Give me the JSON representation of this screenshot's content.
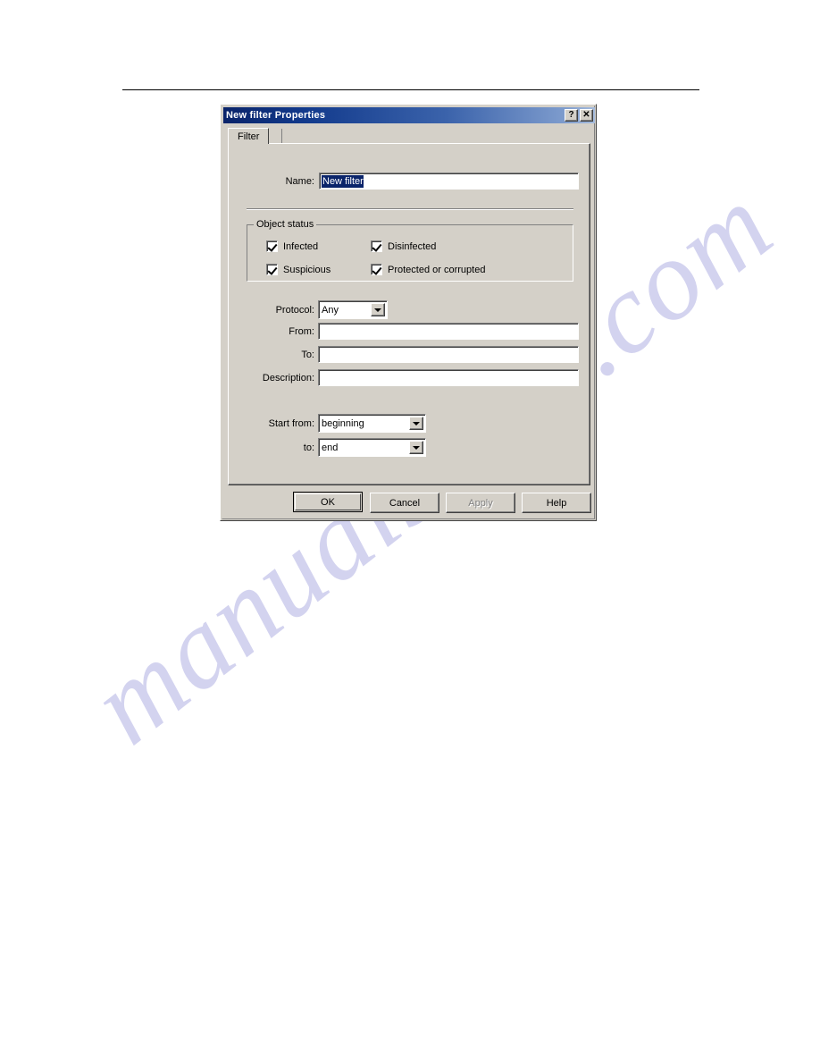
{
  "page": {
    "watermark_text": "manualshive.com"
  },
  "dialog": {
    "title": "New filter Properties",
    "titlebar_buttons": [
      {
        "name": "help-button",
        "glyph": "?"
      },
      {
        "name": "close-button",
        "glyph": "✕"
      }
    ],
    "tabs": [
      {
        "label": "Filter",
        "selected": true
      }
    ],
    "name_field": {
      "label": "Name:",
      "value": "New filter",
      "placeholder": "",
      "selected": true
    },
    "object_status": {
      "legend": "Object status",
      "checkboxes": [
        {
          "label": "Infected",
          "checked": true
        },
        {
          "label": "Disinfected",
          "checked": true
        },
        {
          "label": "Suspicious",
          "checked": true
        },
        {
          "label": "Protected or corrupted",
          "checked": true
        }
      ]
    },
    "protocol": {
      "label": "Protocol:",
      "value": "Any",
      "options": [
        "Any"
      ]
    },
    "from": {
      "label": "From:",
      "value": "",
      "placeholder": ""
    },
    "to": {
      "label": "To:",
      "value": "",
      "placeholder": ""
    },
    "description": {
      "label": "Description:",
      "value": "",
      "placeholder": ""
    },
    "start_from": {
      "label": "Start from:",
      "value": "beginning",
      "options": [
        "beginning"
      ]
    },
    "end_to": {
      "label": "to:",
      "value": "end",
      "options": [
        "end"
      ]
    },
    "buttons": [
      {
        "label": "OK",
        "state": "default"
      },
      {
        "label": "Cancel",
        "state": "normal"
      },
      {
        "label": "Apply",
        "state": "disabled"
      },
      {
        "label": "Help",
        "state": "normal"
      }
    ]
  },
  "colors": {
    "dialog_face": "#d4d0c8",
    "title_dark": "#0a246a",
    "title_light": "#a6bcdd",
    "selection": "#0a246a",
    "watermark": "#b9b9e6"
  }
}
